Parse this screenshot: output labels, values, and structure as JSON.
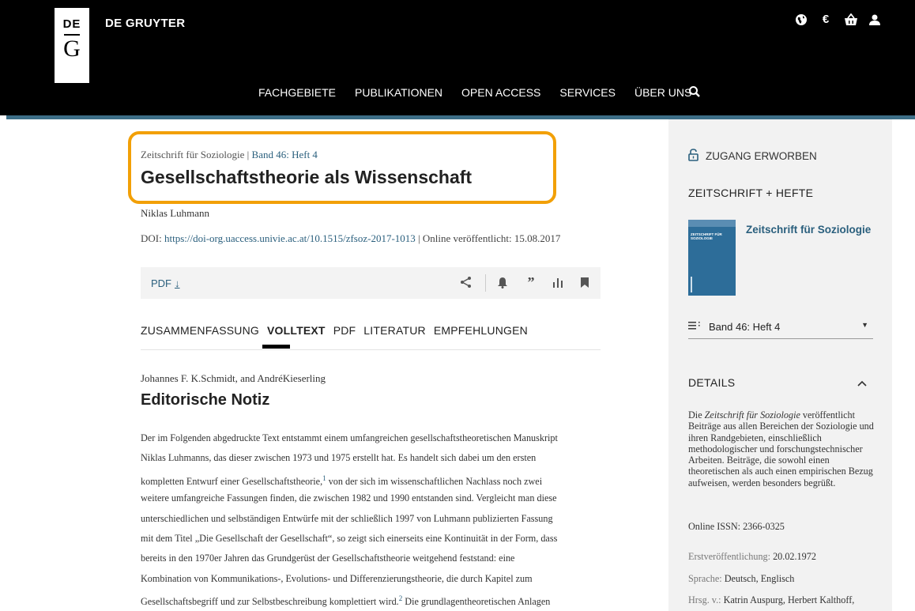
{
  "header": {
    "logo_top": "DE",
    "logo_bottom": "G",
    "brand": "DE GRUYTER",
    "icons": [
      "globe-icon",
      "euro-icon",
      "basket-icon",
      "user-icon"
    ],
    "currency_symbol": "€",
    "nav": [
      "FACHGEBIETE",
      "PUBLIKATIONEN",
      "OPEN ACCESS",
      "SERVICES",
      "ÜBER UNS"
    ],
    "search_icon": "search-icon"
  },
  "article": {
    "journal": "Zeitschrift für Soziologie",
    "separator": " | ",
    "issue": "Band 46: Heft 4",
    "title": "Gesellschaftstheorie als Wissenschaft",
    "author": "Niklas Luhmann",
    "doi_label": "DOI:",
    "doi_url": "https://doi-org.uaccess.univie.ac.at/10.1515/zfsoz-2017-1013",
    "online_label": "| Online veröffentlicht:",
    "online_date": "15.08.2017"
  },
  "toolbar": {
    "pdf_label": "PDF",
    "pdf_icon": "↓",
    "icons": [
      "share-icon",
      "bell-icon",
      "quote-icon",
      "metrics-icon",
      "bookmark-icon"
    ]
  },
  "tabs": [
    {
      "label": "ZUSAMMENFASSUNG",
      "active": false
    },
    {
      "label": "VOLLTEXT",
      "active": true
    },
    {
      "label": "PDF",
      "active": false
    },
    {
      "label": "LITERATUR",
      "active": false
    },
    {
      "label": "EMPFEHLUNGEN",
      "active": false
    }
  ],
  "content": {
    "editors": "Johannes F. K.Schmidt, and AndréKieserling",
    "section_title": "Editorische Notiz",
    "lines": [
      "Der im Folgenden abgedruckte Text entstammt einem umfangreichen gesellschaftstheoretischen Manuskript",
      "Niklas Luhmanns, das dieser zwischen 1973 und 1975 erstellt hat. Es handelt sich dabei um den ersten",
      "kompletten Entwurf einer Gesellschaftstheorie,",
      "weitere umfangreiche Fassungen finden, die zwischen 1982 und 1990 entstanden sind. Vergleicht man diese",
      "unterschiedlichen und selbständigen Entwürfe mit der schließlich 1997 von Luhmann publizierten Fassung",
      "mit dem Titel „Die Gesellschaft der Gesellschaft“, so zeigt sich einerseits eine Kontinuität in der Form, dass",
      "bereits in den 1970er Jahren das Grundgerüst der Gesellschaftstheorie weitgehend feststand: eine",
      "Kombination von Kommunikations-, Evolutions- und Differenzierungstheorie, die durch Kapitel zum",
      "Gesellschaftsbegriff und zur Selbstbeschreibung komplettiert wird."
    ],
    "line3_sup": "1",
    "line3_rest": " von der sich im wissenschaftlichen Nachlass noch zwei",
    "line9_sup": "2",
    "line9_rest": " Die grundlagentheoretischen Anlagen"
  },
  "sidebar": {
    "access": "ZUGANG ERWORBEN",
    "journal_heading": "ZEITSCHRIFT + HEFTE",
    "journal_name": "Zeitschrift für Soziologie",
    "cover_text": "ZEITSCHRIFT FÜR SOZIOLOGIE",
    "issue_selected": "Band 46: Heft 4",
    "details_heading": "DETAILS",
    "details_intro": "Die ",
    "details_journal": "Zeitschrift für Soziologie",
    "details_rest": " veröffentlicht Beiträge aus allen Bereichen der Soziologie und ihren Randgebieten, einschließlich methodologischer und forschungstechnischer Arbeiten. Beiträge, die sowohl einen theoretischen als auch einen empirischen Bezug aufweisen, werden besonders begrüßt.",
    "issn_label": "Online ISSN:",
    "issn": "2366-0325",
    "first_pub_label": "Erstveröffentlichung:",
    "first_pub": "20.02.1972",
    "language_label": "Sprache:",
    "language": "Deutsch, Englisch",
    "editors_label": "Hrsg. v.:",
    "editors": "Katrin Auspurg, Herbert Kalthoff,"
  },
  "colors": {
    "accent": "#2a5f7d",
    "highlight": "#f2a007",
    "header_bg": "#000000",
    "stripe": "#3d6e87",
    "sidebar_bg": "#f2f2f2"
  }
}
